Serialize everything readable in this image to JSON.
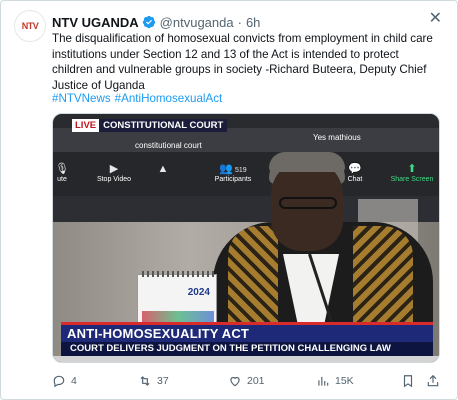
{
  "account": {
    "name": "NTV UGANDA",
    "handle": "@ntvuganda",
    "separator": "·",
    "time": "6h",
    "avatar_text_1": "NTV",
    "avatar_text_2": ""
  },
  "tweet": {
    "line1": "The disqualification of homosexual convicts from employment in child care",
    "line2": "institutions under Section 12 and 13 of the Act is intended to protect",
    "line3": "children and vulnerable groups in society -Richard Buteera, Deputy Chief",
    "line4": "Justice of Uganda",
    "hashtags": [
      "#NTVNews",
      "#AntiHomosexualAct"
    ]
  },
  "media": {
    "live_label": "LIVE",
    "channel_label": "CONSTITUTIONAL COURT",
    "participant_name": "constitutional court",
    "participant_name_2": "Yes mathious",
    "controls": [
      {
        "icon": "mic-icon",
        "glyph": "🎙",
        "label": "ute"
      },
      {
        "icon": "video-icon",
        "glyph": "▶",
        "label": "Stop Video"
      },
      {
        "icon": "security-icon",
        "glyph": "▲",
        "label": ""
      },
      {
        "icon": "participants-icon",
        "glyph": "👥",
        "label": "Participants",
        "count": "519"
      },
      {
        "icon": "chat-icon",
        "glyph": "💬",
        "label": "Chat"
      },
      {
        "icon": "share-screen-icon",
        "glyph": "⬆",
        "label": "Share Screen"
      }
    ],
    "calendar_year": "2024",
    "headline": "ANTI-HOMOSEXUALITY ACT",
    "subheadline": "COURT DELIVERS JUDGMENT ON THE PETITION CHALLENGING LAW"
  },
  "actions": {
    "replies": "4",
    "retweets": "37",
    "likes": "201",
    "views": "15K"
  },
  "colors": {
    "link": "#1d9bf0",
    "verified": "#1d9bf0",
    "muted": "#536471",
    "banner": "#1e2a78"
  }
}
